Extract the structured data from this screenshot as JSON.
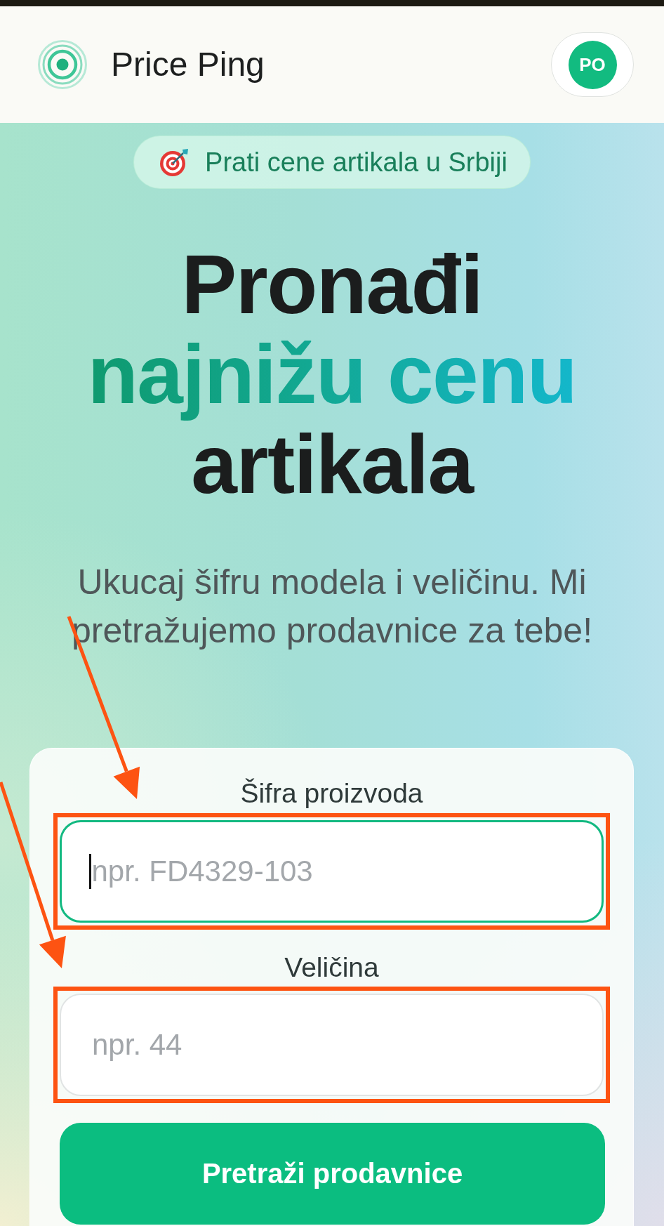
{
  "header": {
    "app_name": "Price Ping",
    "avatar_initials": "PO"
  },
  "tagline": {
    "text": "Prati cene artikala u Srbiji"
  },
  "hero": {
    "title_parts": [
      {
        "text": "Pronađi",
        "kind": "plain"
      },
      {
        "text": "najnižu cenu",
        "kind": "accent"
      },
      {
        "text": "artikala",
        "kind": "plain"
      }
    ],
    "subtitle": "Ukucaj šifru modela i veličinu. Mi pretražujemo prodavnice za tebe!"
  },
  "form": {
    "fields": [
      {
        "label": "Šifra proizvoda",
        "placeholder": "npr. FD4329-103",
        "focused": true,
        "highlighted": true
      },
      {
        "label": "Veličina",
        "placeholder": "npr. 44",
        "focused": false,
        "highlighted": true
      }
    ],
    "submit_button": "Pretraži prodavnice"
  }
}
